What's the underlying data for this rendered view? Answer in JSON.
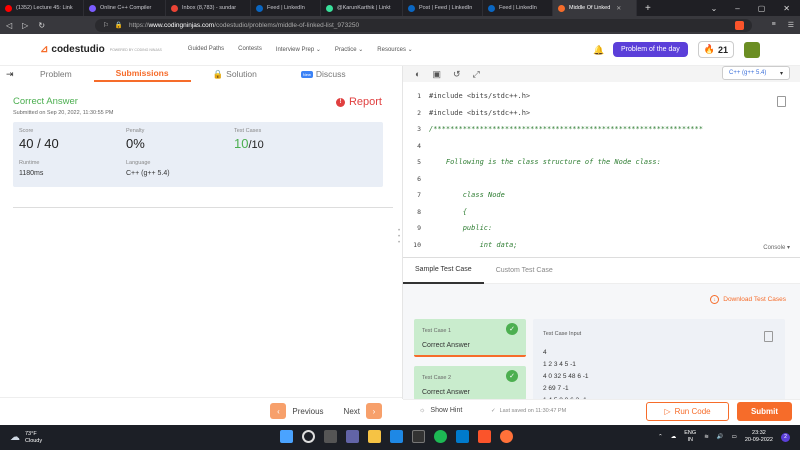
{
  "browser": {
    "tabs": [
      {
        "label": "(1352) Lecture 45: Link",
        "color": "#ff0000"
      },
      {
        "label": "Online C++ Compiler",
        "color": "#7b5cff"
      },
      {
        "label": "Inbox (8,783) - sundar",
        "color": "#ea4335"
      },
      {
        "label": "Feed | LinkedIn",
        "color": "#0a66c2"
      },
      {
        "label": "@KarunKarthik | Linkt",
        "color": "#39e09b"
      },
      {
        "label": "Post | Feed | LinkedIn",
        "color": "#0a66c2"
      },
      {
        "label": "Feed | LinkedIn",
        "color": "#0a66c2"
      },
      {
        "label": "Middle Of Linked",
        "color": "#f66c2a"
      }
    ],
    "new_tab": "+",
    "url_prefix": "https://",
    "url_host": "www.codingninjas.com",
    "url_path": "/codestudio/problems/middle-of-linked-list_973250"
  },
  "site": {
    "logo_text": "codestudio",
    "logo_sub": "POWERED BY CODING NINJAS",
    "nav": [
      "Guided Paths",
      "Contests",
      "Interview Prep",
      "Practice",
      "Resources"
    ],
    "potd": "Problem of the day",
    "streak": "21"
  },
  "left": {
    "tabs": {
      "problem": "Problem",
      "submissions": "Submissions",
      "solution": "Solution",
      "discuss": "Discuss",
      "new_badge": "New"
    },
    "verdict": "Correct Answer",
    "submitted": "Submitted on Sep 20, 2022, 11:30:55 PM",
    "report": "Report",
    "score_label": "Score",
    "score_value": "40 / 40",
    "penalty_label": "Penalty",
    "penalty_value": "0%",
    "testcases_label": "Test Cases",
    "testcases_passed": "10",
    "testcases_total": "/10",
    "runtime_label": "Runtime",
    "runtime_value": "1180ms",
    "language_label": "Language",
    "language_value": "C++ (g++ 5.4)",
    "previous": "Previous",
    "next": "Next"
  },
  "editor": {
    "language": "C++ (g++ 5.4)",
    "lines": [
      {
        "n": "1",
        "text": "#include <bits/stdc++.h>",
        "kind": "inc"
      },
      {
        "n": "2",
        "text": "#include <bits/stdc++.h>",
        "kind": "inc"
      },
      {
        "n": "3",
        "text": "/****************************************************************",
        "kind": "c"
      },
      {
        "n": "4",
        "text": "",
        "kind": "c"
      },
      {
        "n": "5",
        "text": "    Following is the class structure of the Node class:",
        "kind": "c"
      },
      {
        "n": "6",
        "text": "",
        "kind": "c"
      },
      {
        "n": "7",
        "text": "        class Node",
        "kind": "c"
      },
      {
        "n": "8",
        "text": "        {",
        "kind": "c"
      },
      {
        "n": "9",
        "text": "        public:",
        "kind": "c"
      },
      {
        "n": "10",
        "text": "            int data;",
        "kind": "c"
      }
    ],
    "console": "Console"
  },
  "tests": {
    "sample_tab": "Sample Test Case",
    "custom_tab": "Custom Test Case",
    "download": "Download Test Cases",
    "case1_label": "Test Case 1",
    "case1_status": "Correct Answer",
    "case2_label": "Test Case 2",
    "case2_status": "Correct Answer",
    "input_header": "Test Case Input",
    "input_lines": [
      "4",
      "1 2 3 4 5 -1",
      "4 0 32 5 48 6 -1",
      "2 69 7 -1",
      "1 4 5 8 0 6 2 -1"
    ]
  },
  "actions": {
    "show_hint": "Show Hint",
    "last_saved": "Last saved on 11:30:47 PM",
    "run_code": "Run Code",
    "submit": "Submit"
  },
  "taskbar": {
    "temp": "73°F",
    "weather": "Cloudy",
    "lang": "ENG",
    "region": "IN",
    "time": "23:32",
    "date": "20-09-2022",
    "notifications": "2"
  }
}
